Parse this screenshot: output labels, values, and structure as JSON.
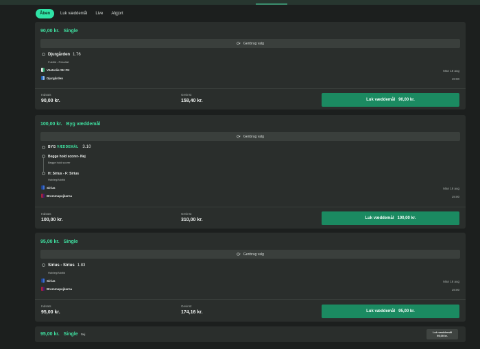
{
  "tabs": [
    {
      "label": "Åben",
      "active": true
    },
    {
      "label": "Luk væddemål",
      "active": false
    },
    {
      "label": "Live",
      "active": false
    },
    {
      "label": "Afgjort",
      "active": false
    }
  ],
  "reuse_label": "Genbrug valg",
  "labels": {
    "stake": "Indsats",
    "return": "Gevinst",
    "cashout": "Luk væddemål"
  },
  "bets": [
    {
      "amount": "90,00 kr.",
      "type": "Single",
      "selection": "Djurgården",
      "odds": "1.76",
      "market": "Fuldtid - Resultat",
      "home": "Västerås SK FK",
      "away": "Djurgården",
      "date": "Man 18 aug",
      "time": "19:00",
      "stake": "90,00 kr.",
      "return": "158,40 kr.",
      "cashout_value": "90,00 kr."
    },
    {
      "amount": "100,00 kr.",
      "type": "Byg væddemål",
      "bb_prefix": "BYG",
      "bb_word": "VÆDDEMÅL",
      "odds": "3.10",
      "legs": [
        {
          "title": "Begge hold scorer- Nej",
          "market": "Begge hold scorer"
        },
        {
          "title": "H: Sirius - F: Sirius",
          "market": "Halvleg/fuldtid"
        }
      ],
      "home": "Sirius",
      "away": "Brommapojkarna",
      "date": "Man 18 aug",
      "time": "19:00",
      "stake": "100,00 kr.",
      "return": "310,00 kr.",
      "cashout_value": "100,00 kr."
    },
    {
      "amount": "95,00 kr.",
      "type": "Single",
      "selection": "Sirius - Sirius",
      "odds": "1.83",
      "market": "Halvleg/fuldtid",
      "home": "Sirius",
      "away": "Brommapojkarna",
      "date": "Man 18 aug",
      "time": "19:00",
      "stake": "95,00 kr.",
      "return": "174,16 kr.",
      "cashout_value": "95,00 kr."
    },
    {
      "amount": "95,00 kr.",
      "type": "Single",
      "note": "Nej",
      "cashout_value": "95,00 kr."
    }
  ],
  "colors": {
    "accent": "#3fe0a0",
    "cashout": "#1b8a61",
    "card": "#2a2e2c",
    "background": "#1c1f1e"
  }
}
